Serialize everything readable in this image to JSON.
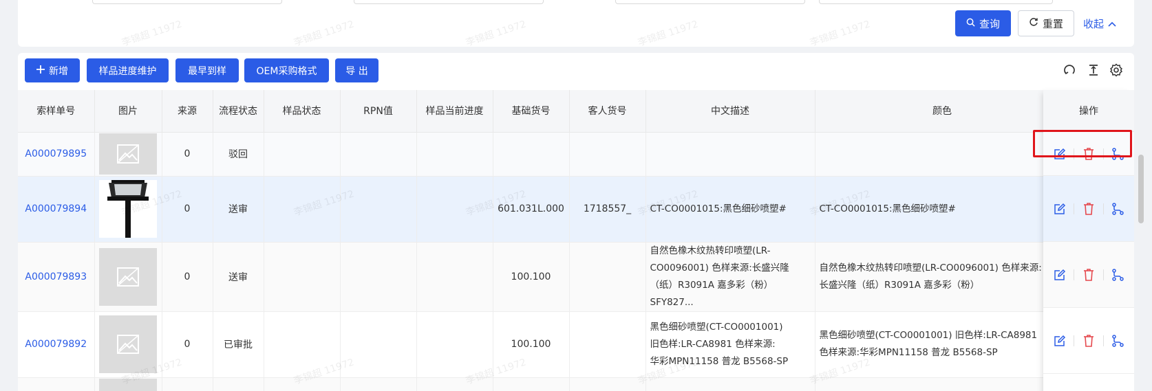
{
  "search": {
    "query_label": "查询",
    "reset_label": "重置",
    "collapse_label": "收起"
  },
  "toolbar": {
    "add_label": "新增",
    "progress_label": "样品进度维护",
    "earliest_label": "最早到样",
    "oem_label": "OEM采购格式",
    "export_label": "导 出"
  },
  "table": {
    "headers": [
      "索样单号",
      "图片",
      "来源",
      "流程状态",
      "样品状态",
      "RPN值",
      "样品当前进度",
      "基础货号",
      "客人货号",
      "中文描述",
      "颜色",
      "操作"
    ],
    "rows": [
      {
        "code": "A000079895",
        "source": "0",
        "flow": "驳回",
        "sample_status": "",
        "rpn": "",
        "progress": "",
        "base_no": "",
        "customer_no": "",
        "desc": "",
        "color": ""
      },
      {
        "code": "A000079894",
        "source": "0",
        "flow": "送审",
        "sample_status": "",
        "rpn": "",
        "progress": "",
        "base_no": "601.031L.000",
        "customer_no": "1718557_",
        "desc": "CT-CO0001015:黑色细砂喷塑#",
        "color": "CT-CO0001015:黑色细砂喷塑#"
      },
      {
        "code": "A000079893",
        "source": "0",
        "flow": "送审",
        "sample_status": "",
        "rpn": "",
        "progress": "",
        "base_no": "100.100",
        "customer_no": "",
        "desc_lines": [
          "自然色橡木纹热转印喷塑(LR-",
          "CO0096001) 色样来源:长盛兴隆",
          "（纸）R3091A 嘉多彩（粉）SFY827..."
        ],
        "color_lines": [
          "自然色橡木纹热转印喷塑(LR-CO0096001) 色样来源:",
          "长盛兴隆（纸）R3091A 嘉多彩（粉）"
        ]
      },
      {
        "code": "A000079892",
        "source": "0",
        "flow": "已审批",
        "sample_status": "",
        "rpn": "",
        "progress": "",
        "base_no": "100.100",
        "customer_no": "",
        "desc_lines": [
          "黑色细砂喷塑(CT-CO0001001)",
          "旧色样:LR-CA8981 色样来源:",
          "华彩MPN11158 普龙 B5568-SP"
        ],
        "color_lines": [
          "黑色细砂喷塑(CT-CO0001001) 旧色样:LR-CA8981",
          "色样来源:华彩MPN11158 普龙 B5568-SP"
        ]
      }
    ]
  },
  "watermark_text": "李锦超 11972",
  "colors": {
    "primary": "#2b5ce6",
    "danger": "#e5484d",
    "highlight": "#e0151b"
  },
  "icons": [
    "search-icon",
    "reset-icon",
    "chevron-up-icon",
    "plus-icon",
    "refresh-icon",
    "density-icon",
    "settings-icon",
    "edit-icon",
    "delete-icon",
    "flow-icon",
    "image-placeholder-icon"
  ]
}
